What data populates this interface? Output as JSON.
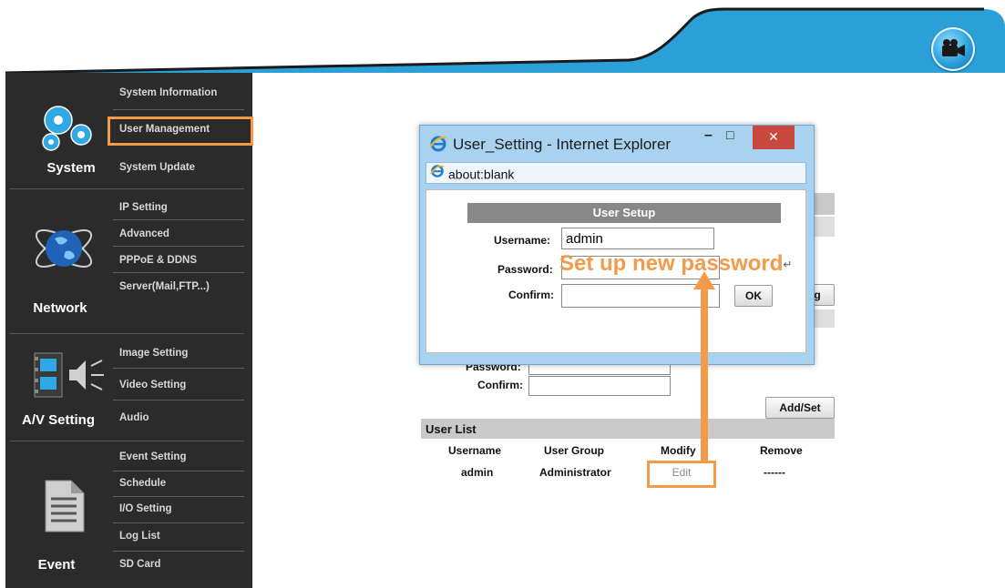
{
  "sidebar": {
    "sections": [
      {
        "label": "System",
        "items": [
          "System Information",
          "User Management",
          "System Update"
        ]
      },
      {
        "label": "Network",
        "items": [
          "IP Setting",
          "Advanced",
          "PPPoE & DDNS",
          "Server(Mail,FTP...)"
        ]
      },
      {
        "label": "A/V Setting",
        "items": [
          "Image Setting",
          "Video Setting",
          "Audio"
        ]
      },
      {
        "label": "Event",
        "items": [
          "Event Setting",
          "Schedule",
          "I/O Setting",
          "Log List",
          "SD Card"
        ]
      }
    ],
    "active_item": "User Management"
  },
  "main": {
    "password_label": "Password:",
    "confirm_label": "Confirm:",
    "add_set_label": "Add/Set",
    "partial_button_label": "g",
    "user_list_title": "User List",
    "columns": [
      "Username",
      "User Group",
      "Modify",
      "Remove"
    ],
    "rows": [
      {
        "username": "admin",
        "group": "Administrator",
        "modify": "Edit",
        "remove": "------"
      }
    ]
  },
  "dialog": {
    "title": "User_Setting - Internet Explorer",
    "address": "about:blank",
    "heading": "User Setup",
    "username_label": "Username:",
    "username_value": "admin",
    "password_label": "Password:",
    "confirm_label": "Confirm:",
    "ok_label": "OK",
    "minimize": "–",
    "maximize": "□",
    "close": "✕"
  },
  "annotation": {
    "text": "Set up new password",
    "return_mark": "↵",
    "color": "#f39a4b"
  },
  "colors": {
    "header_blue": "#2a9fd8",
    "sidebar_bg": "#2b2b2b",
    "highlight": "#f39a4b"
  }
}
